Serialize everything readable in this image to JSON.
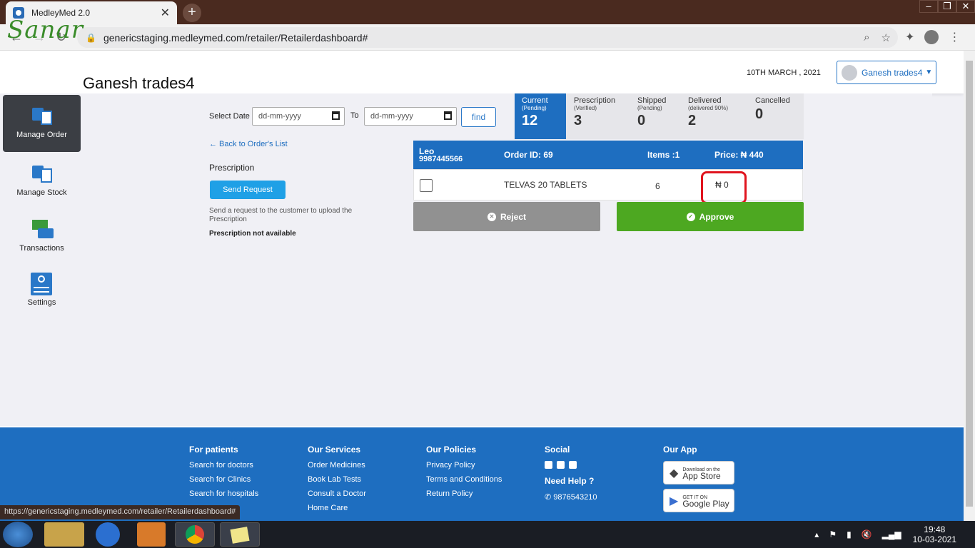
{
  "browser": {
    "tab_title": "MedleyMed 2.0",
    "tab_close": "✕",
    "new_tab": "+",
    "url": "genericstaging.medleymed.com/retailer/Retailerdashboard#",
    "status_url": "https://genericstaging.medleymed.com/retailer/Retailerdashboard#"
  },
  "header": {
    "logo_text": "Sanar",
    "shop_name": "Ganesh trades4",
    "date": "10TH MARCH , 2021",
    "user_name": "Ganesh trades4"
  },
  "sidebar": {
    "items": [
      {
        "label": "Manage Order"
      },
      {
        "label": "Manage Stock"
      },
      {
        "label": "Transactions"
      },
      {
        "label": "Settings"
      }
    ]
  },
  "filter": {
    "select_date_label": "Select Date",
    "from_placeholder": "dd-mm-yyyy",
    "to_label": "To",
    "to_placeholder": "dd-mm-yyyy",
    "find_label": "find"
  },
  "status_tabs": [
    {
      "title": "Current",
      "sub": "(Pending)",
      "count": "12"
    },
    {
      "title": "Prescription",
      "sub": "(Verified)",
      "count": "3"
    },
    {
      "title": "Shipped",
      "sub": "(Pending)",
      "count": "0"
    },
    {
      "title": "Delivered",
      "sub": "(delivered 90%)",
      "count": "2"
    },
    {
      "title": "Cancelled",
      "sub": "",
      "count": "0"
    }
  ],
  "prescription": {
    "back_link": "← Back to Order's List",
    "title": "Prescription",
    "send_button": "Send Request",
    "note": "Send a request to the customer to upload the Prescription",
    "not_available": "Prescription not available"
  },
  "order": {
    "customer_name": "Leo",
    "customer_phone": "9987445566",
    "order_id": "Order ID: 69",
    "items": "Items :1",
    "price": "Price: ₦ 440",
    "rows": [
      {
        "medicine": "TELVAS 20 TABLETS",
        "qty": "6",
        "price": "₦ 0"
      }
    ],
    "reject_label": "Reject",
    "approve_label": "Approve"
  },
  "footer": {
    "patients": {
      "heading": "For patients",
      "links": [
        "Search for doctors",
        "Search for Clinics",
        "Search for hospitals"
      ]
    },
    "services": {
      "heading": "Our Services",
      "links": [
        "Order Medicines",
        "Book Lab Tests",
        "Consult a Doctor",
        "Home Care"
      ]
    },
    "policies": {
      "heading": "Our Policies",
      "links": [
        "Privacy Policy",
        "Terms and Conditions",
        "Return Policy"
      ]
    },
    "social": {
      "heading": "Social",
      "help": "Need Help ?",
      "phone": "9876543210"
    },
    "app": {
      "heading": "Our App",
      "appstore_small": "Download on the",
      "appstore": "App Store",
      "play_small": "GET IT ON",
      "play": "Google Play"
    }
  },
  "taskbar": {
    "time": "19:48",
    "date": "10-03-2021"
  },
  "colors": {
    "primary": "#1e6ec0",
    "approve": "#4da821",
    "reject": "#919191",
    "highlight": "#e0141e"
  }
}
